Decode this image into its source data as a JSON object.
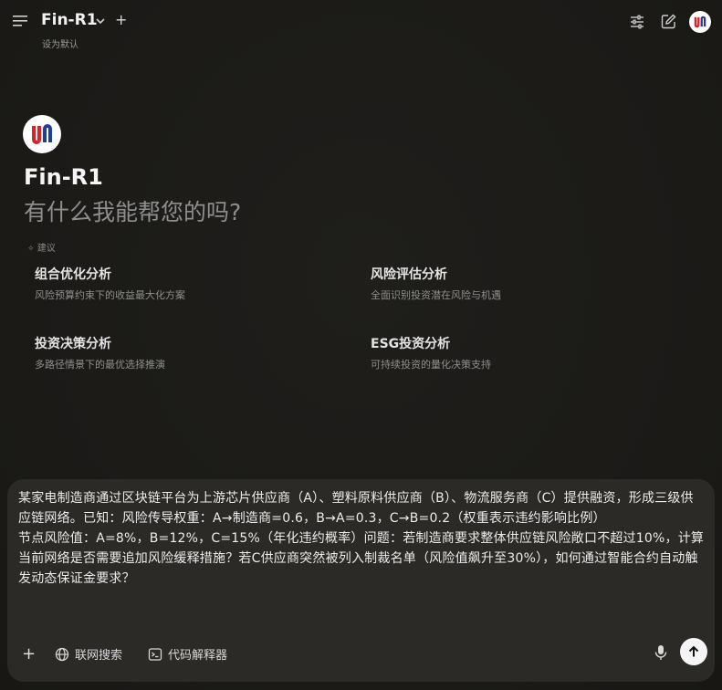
{
  "header": {
    "model_name": "Fin-R1",
    "set_default": "设为默认",
    "new_chat": "+"
  },
  "hero": {
    "title": "Fin-R1",
    "subtitle": "有什么我能帮您的吗?"
  },
  "suggestions": {
    "label": "建议",
    "items": [
      {
        "title": "组合优化分析",
        "desc": "风险预算约束下的收益最大化方案"
      },
      {
        "title": "风险评估分析",
        "desc": "全面识别投资潜在风险与机遇"
      },
      {
        "title": "投资决策分析",
        "desc": "多路径情景下的最优选择推演"
      },
      {
        "title": "ESG投资分析",
        "desc": "可持续投资的量化决策支持"
      }
    ]
  },
  "composer": {
    "text": "某家电制造商通过区块链平台为上游芯片供应商（A）、塑料原料供应商（B）、物流服务商（C）提供融资，形成三级供应链网络。已知：风险传导权重：A→制造商=0.6，B→A=0.3，C→B=0.2（权重表示违约影响比例）\n节点风险值：A=8%，B=12%，C=15%（年化违约概率）问题：若制造商要求整体供应链风险敞口不超过10%，计算当前网络是否需要追加风险缓释措施？若C供应商突然被列入制裁名单（风险值飙升至30%），如何通过智能合约自动触发动态保证金要求？",
    "add": "+",
    "web_search": "联网搜索",
    "code_interpreter": "代码解释器"
  },
  "colors": {
    "background": "#1e1d1a",
    "card": "#2b2a27",
    "logo_red": "#d8232a",
    "logo_blue": "#1f3f94"
  }
}
